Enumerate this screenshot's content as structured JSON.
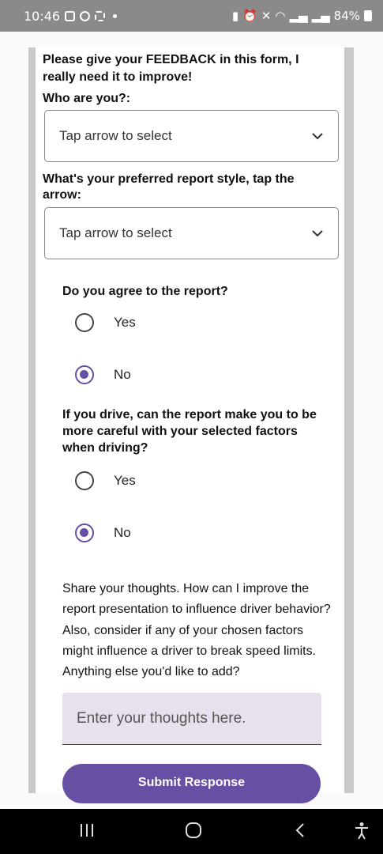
{
  "status_bar": {
    "time": "10:46",
    "battery": "84%",
    "left_icons": [
      "gallery-icon",
      "whatsapp-icon",
      "screenshot-icon"
    ],
    "right_icons": [
      "battery-saver-icon",
      "alarm-icon",
      "mute-icon",
      "wifi-icon",
      "signal-icon",
      "signal-icon"
    ]
  },
  "form": {
    "intro": "Please give your FEEDBACK in this form, I really need it to improve!",
    "who_label": "Who are you?:",
    "who_select": "Tap arrow to select",
    "style_label": "What's your preferred report style, tap the arrow:",
    "style_select": "Tap arrow to select",
    "q1": {
      "text": "Do you agree to the report?",
      "options": [
        "Yes",
        "No"
      ],
      "selected": "No"
    },
    "q2": {
      "text": "If you drive, can the report make you to be more careful with your selected factors when driving?",
      "options": [
        "Yes",
        "No"
      ],
      "selected": "No"
    },
    "share_text": "Share your thoughts. How can I improve the report presentation to influence driver behavior? Also, consider if any of your chosen factors might influence a driver to break speed limits. Anything else you'd like to add?",
    "thoughts_placeholder": "Enter your thoughts here.",
    "submit_label": "Submit Response"
  },
  "colors": {
    "accent": "#6750a4",
    "input_fill": "#e8e0ec",
    "rail": "#c9c9c9"
  }
}
